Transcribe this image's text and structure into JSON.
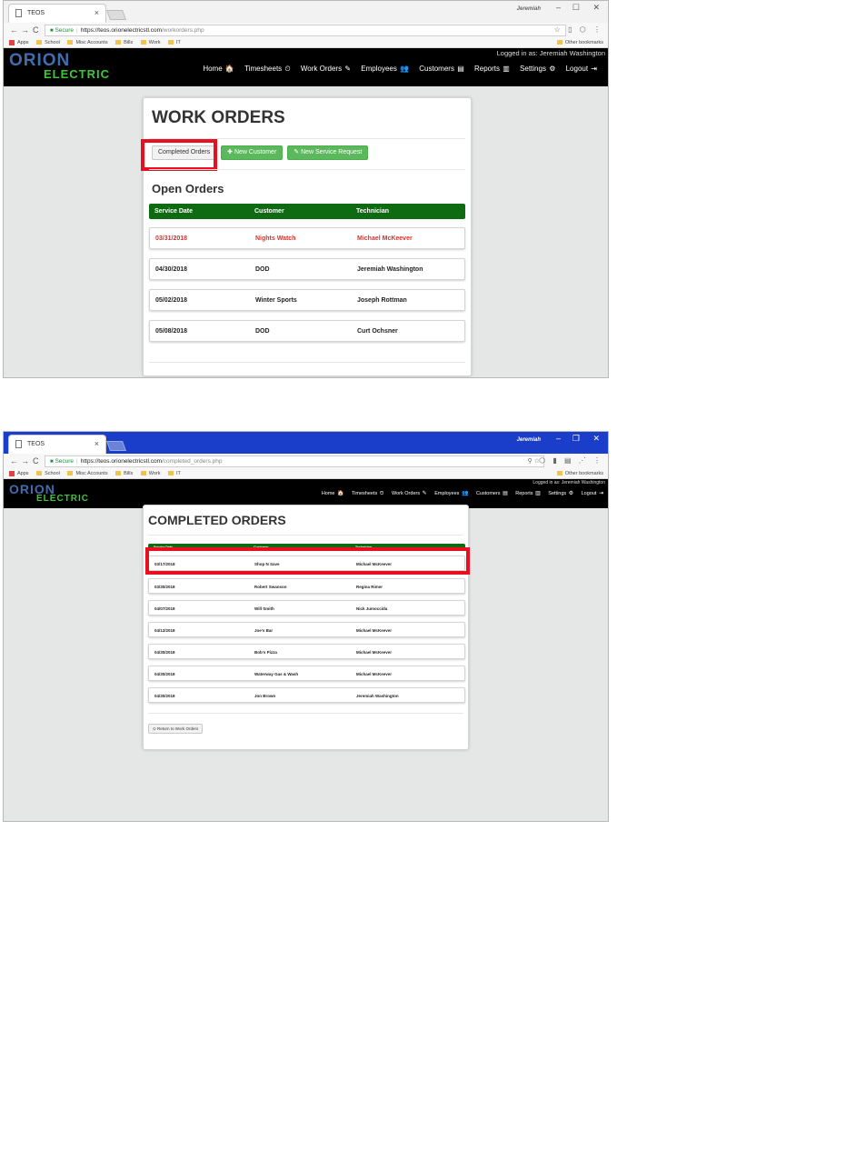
{
  "screenshot1": {
    "browser": {
      "tab_title": "TEOS",
      "tab_close": "×",
      "profile": "Jeremiah",
      "win_min": "–",
      "win_max": "☐",
      "win_close": "✕",
      "nav_back": "←",
      "nav_forward": "→",
      "nav_reload": "C",
      "secure_label": "Secure",
      "url_host": "https://teos.orionelectricstl.com",
      "url_path": "/workorders.php",
      "toolbar_icons": "☆ ▯ ⬡ ⋮",
      "bookmarks": [
        "Apps",
        "School",
        "Misc Accounts",
        "Bills",
        "Work",
        "IT"
      ],
      "other_bookmarks": "Other bookmarks"
    },
    "site": {
      "logo_top": "ORION",
      "logo_bottom": "ELECTRIC",
      "logged_in": "Logged in as: Jeremiah Washington",
      "nav": [
        {
          "label": "Home",
          "icon": "🏠"
        },
        {
          "label": "Timesheets",
          "icon": "⏲"
        },
        {
          "label": "Work Orders",
          "icon": "✎"
        },
        {
          "label": "Employees",
          "icon": "👥"
        },
        {
          "label": "Customers",
          "icon": "▤"
        },
        {
          "label": "Reports",
          "icon": "▥"
        },
        {
          "label": "Settings",
          "icon": "⚙"
        },
        {
          "label": "Logout",
          "icon": "⇥"
        }
      ]
    },
    "page": {
      "title": "WORK ORDERS",
      "btn_completed": "Completed Orders",
      "btn_new_customer": "New Customer",
      "btn_new_customer_icon": "✚",
      "btn_new_service": "New Service Request",
      "btn_new_service_icon": "✎",
      "subtitle": "Open Orders",
      "columns": [
        "Service Date",
        "Customer",
        "Technician"
      ],
      "rows": [
        {
          "date": "03/31/2018",
          "customer": "Nights Watch",
          "technician": "Michael McKeever",
          "highlight": "red"
        },
        {
          "date": "04/30/2018",
          "customer": "DOD",
          "technician": "Jeremiah Washington"
        },
        {
          "date": "05/02/2018",
          "customer": "Winter Sports",
          "technician": "Joseph Rottman"
        },
        {
          "date": "05/08/2018",
          "customer": "DOD",
          "technician": "Curt Ochsner"
        }
      ]
    }
  },
  "screenshot2": {
    "browser": {
      "tab_title": "TEOS",
      "tab_close": "×",
      "profile": "Jeremiah",
      "win_min": "–",
      "win_max": "❐",
      "win_close": "✕",
      "nav_back": "←",
      "nav_forward": "→",
      "nav_reload": "C",
      "secure_label": "Secure",
      "url_host": "https://teos.orionelectricstl.com",
      "url_path": "/completed_orders.php",
      "omni_icons": "⚲ ☆",
      "toolbar_icons": "⬡ ▮ ▤ ⋰ ⋮",
      "bookmarks": [
        "Apps",
        "School",
        "Misc Accounts",
        "Bills",
        "Work",
        "IT"
      ],
      "other_bookmarks": "Other bookmarks"
    },
    "site": {
      "logo_top": "ORION",
      "logo_bottom": "ELECTRIC",
      "logged_in": "Logged in as: Jeremiah Washington",
      "nav": [
        {
          "label": "Home",
          "icon": "🏠"
        },
        {
          "label": "Timesheets",
          "icon": "⏲"
        },
        {
          "label": "Work Orders",
          "icon": "✎"
        },
        {
          "label": "Employees",
          "icon": "👥"
        },
        {
          "label": "Customers",
          "icon": "▤"
        },
        {
          "label": "Reports",
          "icon": "▥"
        },
        {
          "label": "Settings",
          "icon": "⚙"
        },
        {
          "label": "Logout",
          "icon": "⇥"
        }
      ]
    },
    "page": {
      "title": "COMPLETED ORDERS",
      "columns": [
        "Service Date",
        "Customer",
        "Technician"
      ],
      "rows": [
        {
          "date": "03/17/2018",
          "customer": "Shop N Save",
          "technician": "Michael McKeever"
        },
        {
          "date": "03/30/2018",
          "customer": "Robert Swanson",
          "technician": "Regina Rimer"
        },
        {
          "date": "04/07/2018",
          "customer": "Will Smith",
          "technician": "Nick Jumoccida"
        },
        {
          "date": "04/12/2018",
          "customer": "Joe's Bar",
          "technician": "Michael McKeever"
        },
        {
          "date": "04/30/2018",
          "customer": "Bob's Pizza",
          "technician": "Michael McKeever"
        },
        {
          "date": "04/30/2018",
          "customer": "Waterway Gas & Wash",
          "technician": "Michael McKeever"
        },
        {
          "date": "04/30/2018",
          "customer": "Jon Brown",
          "technician": "Jeremiah Washington"
        }
      ],
      "return_button": "Return to Work Orders",
      "return_icon": "⊙"
    }
  },
  "colors": {
    "nav_bg": "#000000",
    "table_header": "#0f6b11",
    "success_button": "#5cb85c",
    "annotation_box": "#e8101f",
    "overdue_text": "#d9302c",
    "active_titlebar": "#1a3ec9"
  }
}
